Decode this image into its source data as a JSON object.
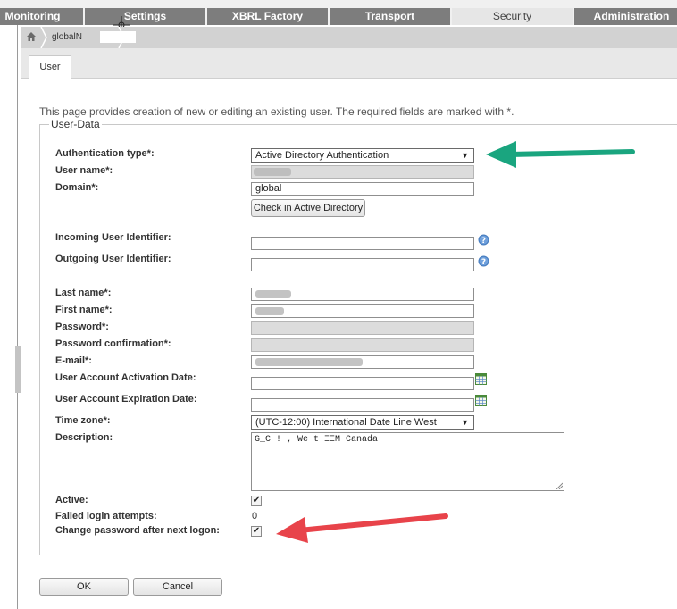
{
  "nav": {
    "tabs": [
      "Monitoring",
      "Settings",
      "XBRL Factory",
      "Transport",
      "Security",
      "Administration"
    ],
    "active": "Security"
  },
  "breadcrumb": {
    "current": "globalN"
  },
  "page": {
    "tab": "User",
    "intro": "This page provides creation of new or editing an existing user. The required fields are marked with *.",
    "legend": "User-Data"
  },
  "form": {
    "auth_type_label": "Authentication type*:",
    "auth_type_value": "Active Directory Authentication",
    "username_label": "User name*:",
    "username_value": "",
    "domain_label": "Domain*:",
    "domain_value": "global",
    "check_ad_label": "Check in Active Directory",
    "incoming_label": "Incoming User Identifier:",
    "outgoing_label": "Outgoing User Identifier:",
    "lastname_label": "Last name*:",
    "firstname_label": "First name*:",
    "password_label": "Password*:",
    "password_confirm_label": "Password confirmation*:",
    "email_label": "E-mail*:",
    "activation_label": "User Account Activation Date:",
    "expiration_label": "User Account Expiration Date:",
    "timezone_label": "Time zone*:",
    "timezone_value": "(UTC-12:00) International Date Line West",
    "description_label": "Description:",
    "description_value": "G_C ! , We t ΞΞM Canada",
    "active_label": "Active:",
    "failed_label": "Failed login attempts:",
    "failed_value": "0",
    "change_pw_label": "Change password after next logon:"
  },
  "buttons": {
    "ok": "OK",
    "cancel": "Cancel"
  },
  "colors": {
    "green_arrow": "#1aa57f",
    "red_arrow": "#e8434a",
    "nav_tab": "#7d7d7d"
  }
}
